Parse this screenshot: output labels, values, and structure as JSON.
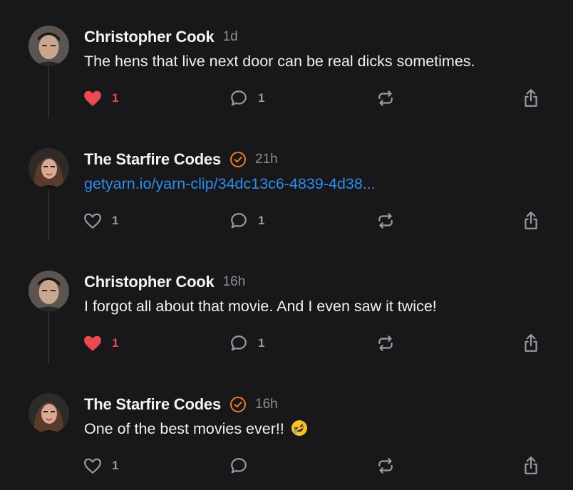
{
  "colors": {
    "background": "#18181a",
    "like": "#ec4a52",
    "link": "#2d8cf0",
    "verified": "#f07a2d",
    "muted": "#8e8e93"
  },
  "posts": [
    {
      "author": "Christopher Cook",
      "time": "1d",
      "verified": false,
      "text": "The hens that live next door can be real dicks sometimes.",
      "is_link": false,
      "likes": "1",
      "liked": true,
      "replies": "1",
      "icons": [
        "heart-filled-icon",
        "reply-bubble-icon",
        "repost-icon",
        "share-icon"
      ]
    },
    {
      "author": "The Starfire Codes",
      "time": "21h",
      "verified": true,
      "text": "getyarn.io/yarn-clip/34dc13c6-4839-4d38...",
      "is_link": true,
      "likes": "1",
      "liked": false,
      "replies": "1",
      "icons": [
        "heart-outline-icon",
        "reply-bubble-icon",
        "repost-icon",
        "share-icon"
      ]
    },
    {
      "author": "Christopher Cook",
      "time": "16h",
      "verified": false,
      "text": "I forgot all about that movie. And I even saw it twice!",
      "is_link": false,
      "likes": "1",
      "liked": true,
      "replies": "1",
      "icons": [
        "heart-filled-icon",
        "reply-bubble-icon",
        "repost-icon",
        "share-icon"
      ]
    },
    {
      "author": "The Starfire Codes",
      "time": "16h",
      "verified": true,
      "text": "One of the best movies ever!!",
      "emoji": "rolling-on-floor-laughing-emoji",
      "is_link": false,
      "likes": "1",
      "liked": false,
      "replies": "",
      "icons": [
        "heart-outline-icon",
        "reply-bubble-icon",
        "repost-icon",
        "share-icon"
      ]
    }
  ]
}
